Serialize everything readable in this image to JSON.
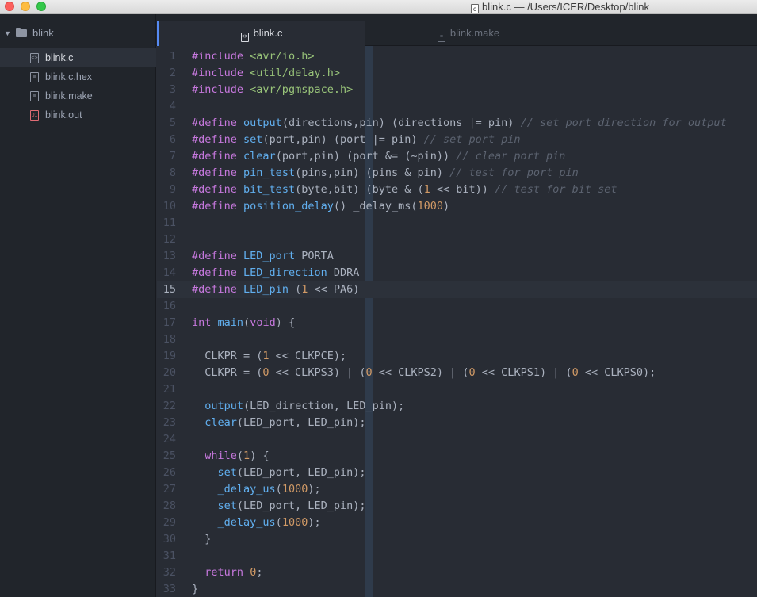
{
  "window": {
    "title": "blink.c — /Users/ICER/Desktop/blink",
    "file_icon_glyph": "c"
  },
  "sidebar": {
    "root": "blink",
    "items": [
      {
        "label": "blink.c",
        "icon": "code-file-icon",
        "glyph": "<>"
      },
      {
        "label": "blink.c.hex",
        "icon": "text-file-icon",
        "glyph": "≡"
      },
      {
        "label": "blink.make",
        "icon": "text-file-icon",
        "glyph": "≡"
      },
      {
        "label": "blink.out",
        "icon": "binary-file-icon",
        "glyph": "01"
      }
    ]
  },
  "tabs": [
    {
      "label": "blink.c",
      "icon": "code-file-icon",
      "glyph": "<>"
    },
    {
      "label": "blink.make",
      "icon": "text-file-icon",
      "glyph": "≡"
    }
  ],
  "colors": {
    "keyword": "#c678dd",
    "string": "#98c379",
    "function": "#61afef",
    "number": "#d19a66",
    "comment": "#5c6370",
    "text": "#abb2bf",
    "accent": "#568af2"
  },
  "editor": {
    "current_line": 15,
    "lines": [
      [
        [
          "kw",
          "#include"
        ],
        [
          "p",
          " "
        ],
        [
          "str",
          "<avr/io.h>"
        ]
      ],
      [
        [
          "kw",
          "#include"
        ],
        [
          "p",
          " "
        ],
        [
          "str",
          "<util/delay.h>"
        ]
      ],
      [
        [
          "kw",
          "#include"
        ],
        [
          "p",
          " "
        ],
        [
          "str",
          "<avr/pgmspace.h>"
        ]
      ],
      [],
      [
        [
          "kw",
          "#define"
        ],
        [
          "p",
          " "
        ],
        [
          "fn",
          "output"
        ],
        [
          "p",
          "(directions,pin) (directions |= pin) "
        ],
        [
          "cmt",
          "// set port direction for output"
        ]
      ],
      [
        [
          "kw",
          "#define"
        ],
        [
          "p",
          " "
        ],
        [
          "fn",
          "set"
        ],
        [
          "p",
          "(port,pin) (port |= pin) "
        ],
        [
          "cmt",
          "// set port pin"
        ]
      ],
      [
        [
          "kw",
          "#define"
        ],
        [
          "p",
          " "
        ],
        [
          "fn",
          "clear"
        ],
        [
          "p",
          "(port,pin) (port &= (~pin)) "
        ],
        [
          "cmt",
          "// clear port pin"
        ]
      ],
      [
        [
          "kw",
          "#define"
        ],
        [
          "p",
          " "
        ],
        [
          "fn",
          "pin_test"
        ],
        [
          "p",
          "(pins,pin) (pins & pin) "
        ],
        [
          "cmt",
          "// test for port pin"
        ]
      ],
      [
        [
          "kw",
          "#define"
        ],
        [
          "p",
          " "
        ],
        [
          "fn",
          "bit_test"
        ],
        [
          "p",
          "(byte,bit) (byte & ("
        ],
        [
          "num",
          "1"
        ],
        [
          "p",
          " << bit)) "
        ],
        [
          "cmt",
          "// test for bit set"
        ]
      ],
      [
        [
          "kw",
          "#define"
        ],
        [
          "p",
          " "
        ],
        [
          "fn",
          "position_delay"
        ],
        [
          "p",
          "() _delay_ms("
        ],
        [
          "num",
          "1000"
        ],
        [
          "p",
          ")"
        ]
      ],
      [],
      [],
      [
        [
          "kw",
          "#define"
        ],
        [
          "p",
          " "
        ],
        [
          "fn",
          "LED_port"
        ],
        [
          "p",
          " PORTA"
        ]
      ],
      [
        [
          "kw",
          "#define"
        ],
        [
          "p",
          " "
        ],
        [
          "fn",
          "LED_direction"
        ],
        [
          "p",
          " DDRA"
        ]
      ],
      [
        [
          "kw",
          "#define"
        ],
        [
          "p",
          " "
        ],
        [
          "fn",
          "LED_pin"
        ],
        [
          "p",
          " ("
        ],
        [
          "num",
          "1"
        ],
        [
          "p",
          " << PA6)"
        ]
      ],
      [],
      [
        [
          "kw",
          "int"
        ],
        [
          "p",
          " "
        ],
        [
          "fn",
          "main"
        ],
        [
          "p",
          "("
        ],
        [
          "kw",
          "void"
        ],
        [
          "p",
          ") {"
        ]
      ],
      [],
      [
        [
          "p",
          "  CLKPR = ("
        ],
        [
          "num",
          "1"
        ],
        [
          "p",
          " << CLKPCE);"
        ]
      ],
      [
        [
          "p",
          "  CLKPR = ("
        ],
        [
          "num",
          "0"
        ],
        [
          "p",
          " << CLKPS3) | ("
        ],
        [
          "num",
          "0"
        ],
        [
          "p",
          " << CLKPS2) | ("
        ],
        [
          "num",
          "0"
        ],
        [
          "p",
          " << CLKPS1) | ("
        ],
        [
          "num",
          "0"
        ],
        [
          "p",
          " << CLKPS0);"
        ]
      ],
      [],
      [
        [
          "p",
          "  "
        ],
        [
          "fn",
          "output"
        ],
        [
          "p",
          "(LED_direction, LED_pin);"
        ]
      ],
      [
        [
          "p",
          "  "
        ],
        [
          "fn",
          "clear"
        ],
        [
          "p",
          "(LED_port, LED_pin);"
        ]
      ],
      [],
      [
        [
          "p",
          "  "
        ],
        [
          "kw",
          "while"
        ],
        [
          "p",
          "("
        ],
        [
          "num",
          "1"
        ],
        [
          "p",
          ") {"
        ]
      ],
      [
        [
          "p",
          "    "
        ],
        [
          "fn",
          "set"
        ],
        [
          "p",
          "(LED_port, LED_pin);"
        ]
      ],
      [
        [
          "p",
          "    "
        ],
        [
          "fn",
          "_delay_us"
        ],
        [
          "p",
          "("
        ],
        [
          "num",
          "1000"
        ],
        [
          "p",
          ");"
        ]
      ],
      [
        [
          "p",
          "    "
        ],
        [
          "fn",
          "set"
        ],
        [
          "p",
          "(LED_port, LED_pin);"
        ]
      ],
      [
        [
          "p",
          "    "
        ],
        [
          "fn",
          "_delay_us"
        ],
        [
          "p",
          "("
        ],
        [
          "num",
          "1000"
        ],
        [
          "p",
          ");"
        ]
      ],
      [
        [
          "p",
          "  }"
        ]
      ],
      [],
      [
        [
          "p",
          "  "
        ],
        [
          "kw",
          "return"
        ],
        [
          "p",
          " "
        ],
        [
          "num",
          "0"
        ],
        [
          "p",
          ";"
        ]
      ],
      [
        [
          "p",
          "}"
        ]
      ]
    ]
  }
}
